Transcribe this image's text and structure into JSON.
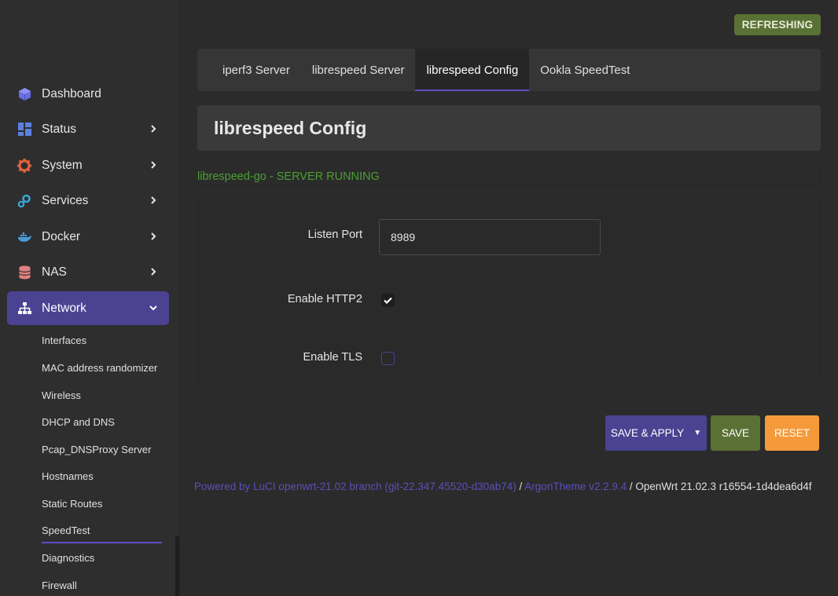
{
  "sidebar": {
    "items": [
      {
        "label": "Dashboard",
        "icon": "cube-icon",
        "has_chevron": false
      },
      {
        "label": "Status",
        "icon": "grid-icon",
        "has_chevron": true
      },
      {
        "label": "System",
        "icon": "gear-icon",
        "has_chevron": true
      },
      {
        "label": "Services",
        "icon": "gears-icon",
        "has_chevron": true
      },
      {
        "label": "Docker",
        "icon": "docker-icon",
        "has_chevron": true
      },
      {
        "label": "NAS",
        "icon": "database-icon",
        "has_chevron": true
      },
      {
        "label": "Network",
        "icon": "network-icon",
        "has_chevron": true,
        "expanded": true
      }
    ],
    "network_sub": [
      "Interfaces",
      "MAC address randomizer",
      "Wireless",
      "DHCP and DNS",
      "Pcap_DNSProxy Server",
      "Hostnames",
      "Static Routes",
      "SpeedTest",
      "Diagnostics",
      "Firewall"
    ],
    "active_sub": "SpeedTest"
  },
  "header": {
    "badge": "REFRESHING"
  },
  "tabs": [
    {
      "label": "iperf3 Server",
      "active": false
    },
    {
      "label": "librespeed Server",
      "active": false
    },
    {
      "label": "librespeed Config",
      "active": true
    },
    {
      "label": "Ookla SpeedTest",
      "active": false
    }
  ],
  "page": {
    "title": "librespeed Config",
    "status": "librespeed-go - SERVER RUNNING"
  },
  "form": {
    "listen_port_label": "Listen Port",
    "listen_port_value": "8989",
    "http2_label": "Enable HTTP2",
    "http2_checked": true,
    "tls_label": "Enable TLS",
    "tls_checked": false
  },
  "buttons": {
    "save_apply": "SAVE & APPLY",
    "save": "SAVE",
    "reset": "RESET"
  },
  "footer": {
    "luci": "Powered by LuCI openwrt-21.02 branch (git-22.347.45520-d30ab74)",
    "sep1": " / ",
    "theme": "ArgonTheme v2.2.9.4",
    "sep2": " / ",
    "openwrt": "OpenWrt 21.02.3 r16554-1d4dea6d4f"
  },
  "colors": {
    "accent": "#4b4391",
    "running": "#4aa030",
    "badge": "#5a7135",
    "save": "#5a7135",
    "reset": "#f49a3a"
  }
}
